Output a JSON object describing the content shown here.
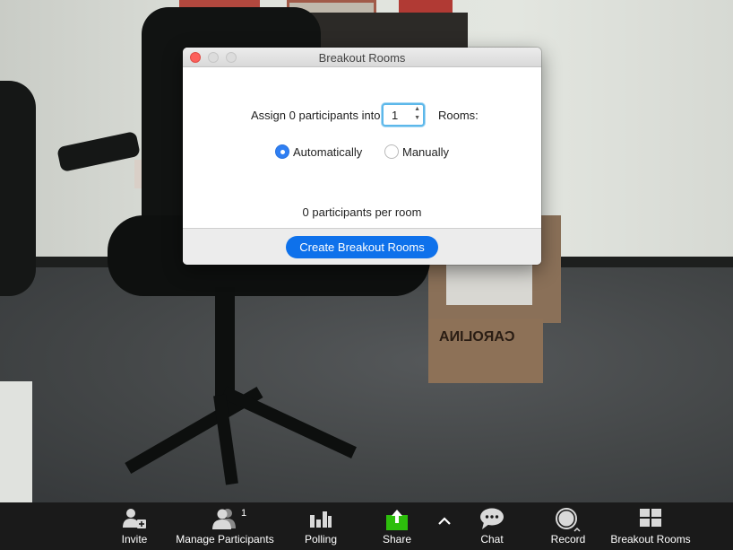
{
  "dialog": {
    "title": "Breakout Rooms",
    "assign_prefix": "Assign 0 participants into",
    "rooms_count": "1",
    "rooms_suffix": "Rooms:",
    "options": [
      {
        "label": "Automatically",
        "selected": true
      },
      {
        "label": "Manually",
        "selected": false
      }
    ],
    "per_room_text": "0 participants per room",
    "create_button": "Create Breakout Rooms",
    "accent_color": "#0e71eb"
  },
  "toolbar": {
    "items": [
      {
        "label": "Invite",
        "icon": "invite-icon"
      },
      {
        "label": "Manage Participants",
        "icon": "participants-icon",
        "badge": "1"
      },
      {
        "label": "Polling",
        "icon": "polling-icon"
      },
      {
        "label": "Share",
        "icon": "share-icon",
        "color": "#2dbe0c"
      },
      {
        "label": "",
        "icon": "chevron-up-icon"
      },
      {
        "label": "Chat",
        "icon": "chat-icon"
      },
      {
        "label": "Record",
        "icon": "record-icon"
      },
      {
        "label": "Breakout Rooms",
        "icon": "breakout-rooms-icon"
      }
    ]
  },
  "background": {
    "box_text": "CAROLINA"
  }
}
